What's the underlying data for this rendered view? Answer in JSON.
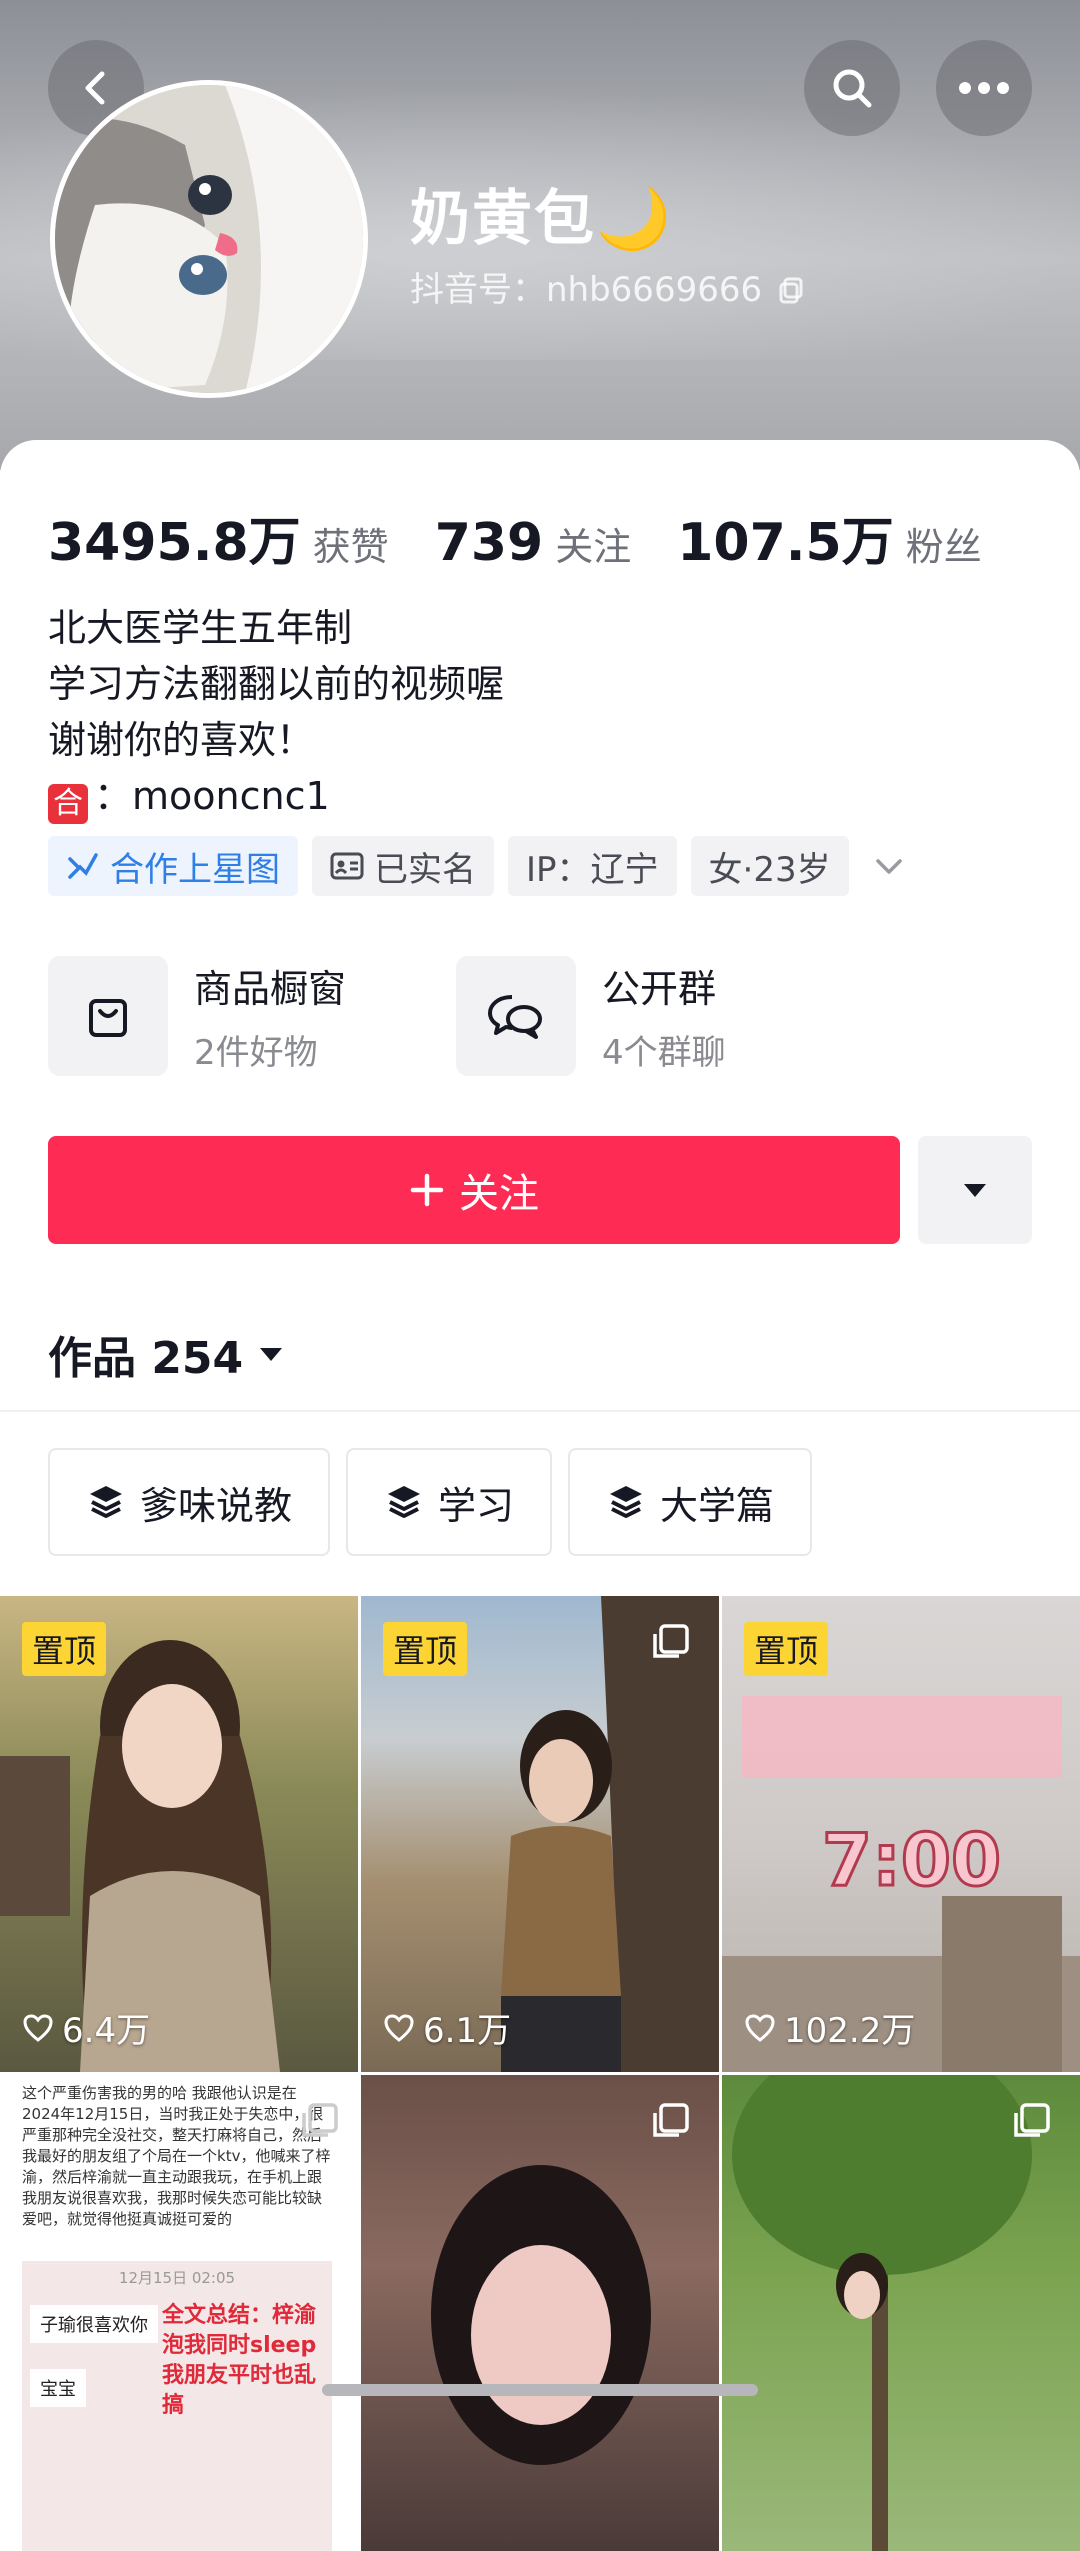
{
  "profile": {
    "nickname": "奶黄包🌙",
    "douyin_id": "抖音号：nhb6669666"
  },
  "stats": [
    {
      "value": "3495.8万",
      "label": "获赞"
    },
    {
      "value": "739",
      "label": "关注"
    },
    {
      "value": "107.5万",
      "label": "粉丝"
    }
  ],
  "bio": {
    "line1": "北大医学生五年制",
    "line2": "学习方法翻翻以前的视频喔",
    "line3": "谢谢你的喜欢！",
    "contact_badge": "合",
    "contact_value": "：mooncnc1"
  },
  "tags": {
    "star_map": "合作上星图",
    "verified": "已实名",
    "ip": "IP：辽宁",
    "gender_age": "女·23岁"
  },
  "services": {
    "shop_title": "商品橱窗",
    "shop_sub": "2件好物",
    "group_title": "公开群",
    "group_sub": "4个群聊"
  },
  "actions": {
    "follow_label": "关注"
  },
  "works": {
    "label": "作品 254"
  },
  "collections": [
    "爹味说教",
    "学习",
    "大学篇"
  ],
  "videos": [
    {
      "pinned": "置顶",
      "likes": "6.4万"
    },
    {
      "pinned": "置顶",
      "likes": "6.1万"
    },
    {
      "pinned": "置顶",
      "likes": "102.2万",
      "overlay_time": "7:00"
    }
  ],
  "screenshot_video": {
    "text": "这个严重伤害我的男的哈 我跟他认识是在2024年12月15日，当时我正处于失恋中，很严重那种完全没社交，整天打麻将自己，然后我最好的朋友组了个局在一个ktv，他喊来了梓渝，然后梓渝就一直主动跟我玩，在手机上跟我朋友说很喜欢我，我那时候失恋可能比较缺爱吧，就觉得他挺真诚挺可爱的",
    "date": "12月15日 02:05",
    "chat1": "子瑜很喜欢你",
    "chat2": "宝宝",
    "summary": "全文总结：梓渝泡我同时sleep我朋友平时也乱搞"
  }
}
